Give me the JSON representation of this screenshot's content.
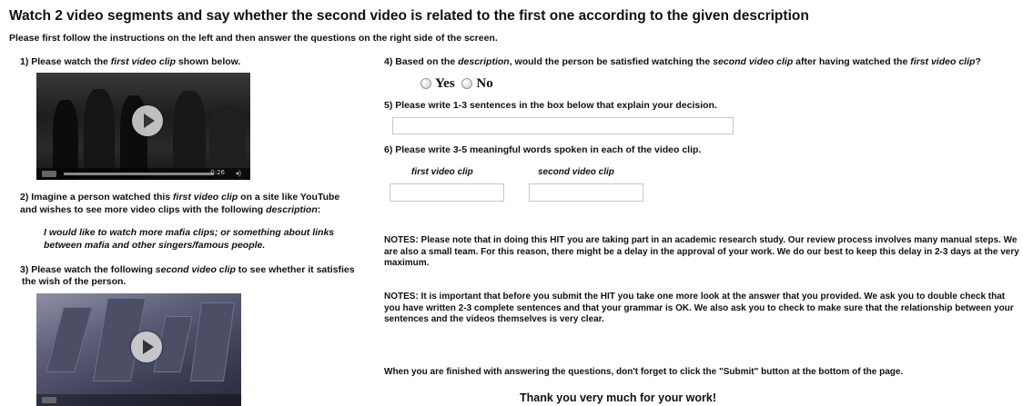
{
  "header": {
    "title": "Watch 2 video segments and say whether the second video is related to the first one according to the given description",
    "subtitle": "Please first follow the instructions on the left and then answer the questions on the right side of the screen."
  },
  "left": {
    "q1_prefix": "1) Please watch the ",
    "q1_em": "first video clip",
    "q1_suffix": " shown below.",
    "video1": {
      "time": "0:26"
    },
    "q2_line1_prefix": "2) Imagine a person watched this ",
    "q2_line1_em": "first video clip",
    "q2_line1_suffix": " on a site like YouTube",
    "q2_line2_prefix": "and wishes to see more video clips with the following ",
    "q2_line2_em": "description",
    "q2_line2_suffix": ":",
    "description_line1": "I would like to watch more mafia clips; or something about links",
    "description_line2": "between mafia and other singers/famous people.",
    "q3_line1_prefix": "3) Please watch the following ",
    "q3_line1_em": "second video clip",
    "q3_line1_suffix": " to see whether it satisfies",
    "q3_line2": "the wish of the person."
  },
  "right": {
    "q4_p1": "4) Based on the ",
    "q4_em1": "description",
    "q4_p2": ", would the person be satisfied watching the ",
    "q4_em2": "second video clip",
    "q4_p3": " after having watched the ",
    "q4_em3": "first video clip",
    "q4_p4": "?",
    "yes_label": "Yes",
    "no_label": "No",
    "q5": "5) Please write 1-3 sentences in the box below that explain your decision.",
    "q6": "6) Please write 3-5 meaningful words spoken in each of the video clip.",
    "first_clip_label": "first video clip",
    "second_clip_label": "second video clip",
    "note1": "NOTES: Please note that in doing this HIT you are taking part in an academic research study. Our review process involves many manual steps. We are also a small team. For this reason, there might be a delay in the approval of your work. We do our best to keep this delay in 2-3 days at the very maximum.",
    "note2": "NOTES: It is important that before you submit the HIT you take one more look at the answer  that you provided. We ask you to double check that you have written 2-3 complete sentences  and that your grammar is OK. We also ask you to check to make sure that the relationship between your sentences and the videos themselves is very clear.",
    "finish_note": "When you are finished with answering the questions, don't forget to click the \"Submit\" button at the bottom of the page.",
    "thanks": "Thank you very much for your work!"
  }
}
